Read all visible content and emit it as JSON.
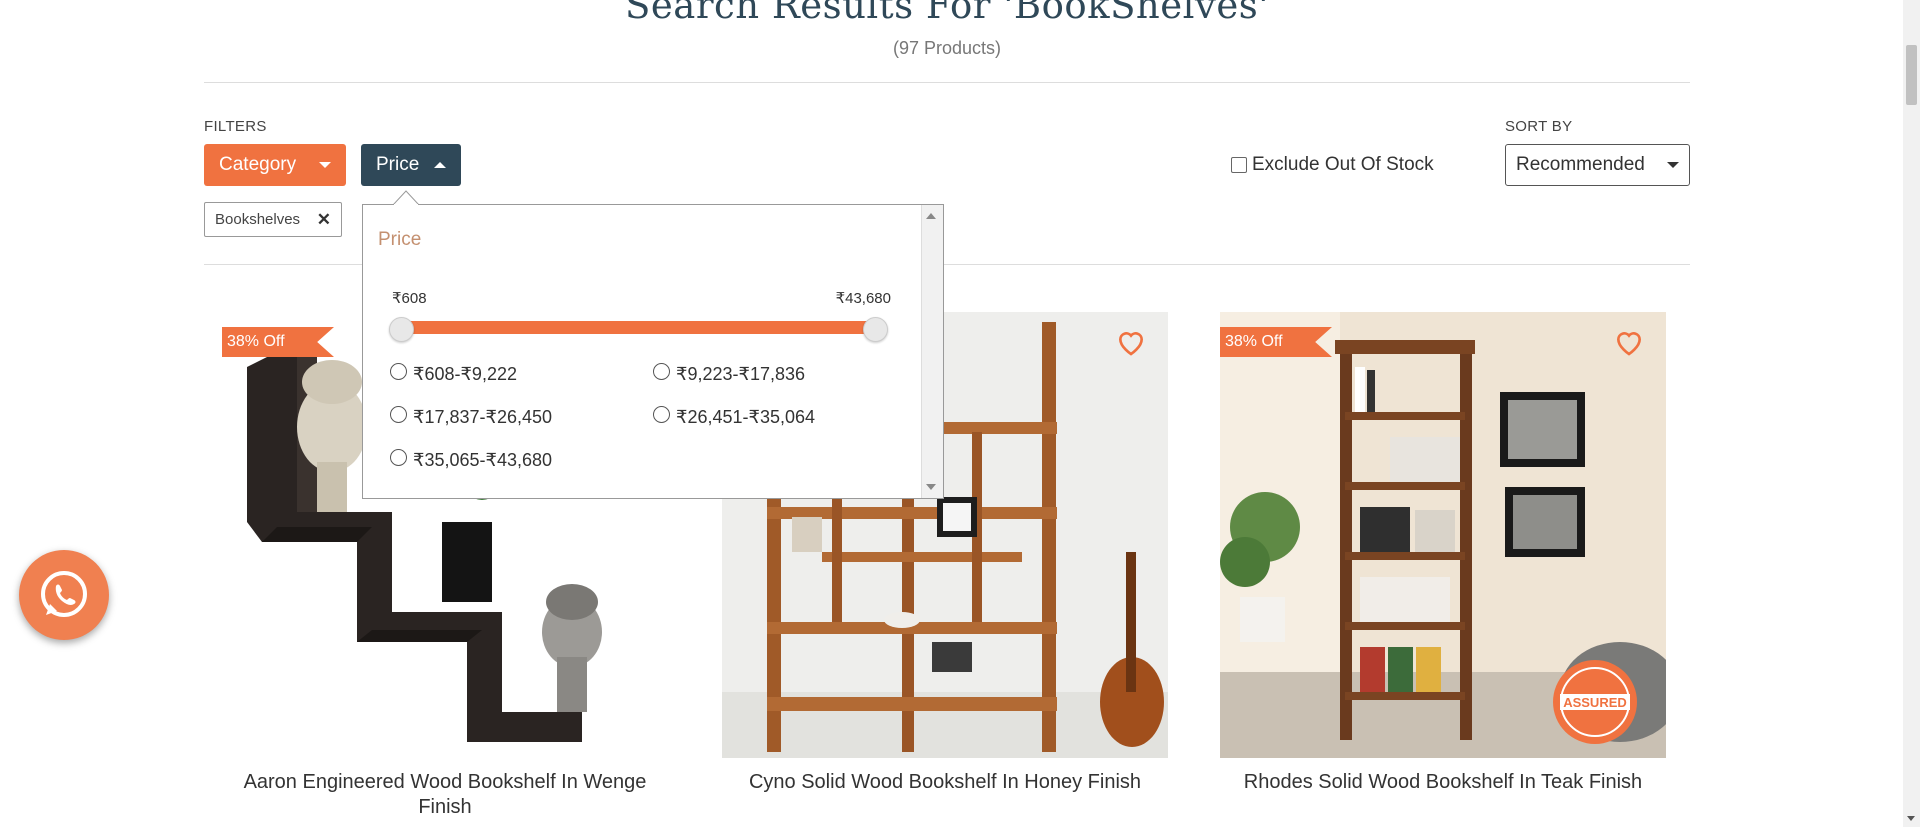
{
  "header": {
    "title": "Search Results For 'BookShelves'",
    "count": "(97 Products)"
  },
  "filters": {
    "label": "FILTERS",
    "category_label": "Category",
    "price_label": "Price",
    "exclude_label": "Exclude Out Of Stock",
    "active_chip": "Bookshelves"
  },
  "sort": {
    "label": "SORT BY",
    "selected": "Recommended"
  },
  "price_panel": {
    "title": "Price",
    "min": "₹608",
    "max": "₹43,680",
    "options": [
      "₹608-₹9,222",
      "₹9,223-₹17,836",
      "₹17,837-₹26,450",
      "₹26,451-₹35,064",
      "₹35,065-₹43,680"
    ]
  },
  "products": [
    {
      "name": "Aaron Engineered Wood Bookshelf In Wenge Finish",
      "badge": "38% Off"
    },
    {
      "name": "Cyno Solid Wood Bookshelf In Honey Finish",
      "badge": ""
    },
    {
      "name": "Rhodes Solid Wood Bookshelf In Teak Finish",
      "badge": "38% Off"
    }
  ],
  "icons": {
    "whatsapp": "whatsapp-icon",
    "wishlist": "heart-icon",
    "remove": "close-icon"
  },
  "colors": {
    "accent": "#f07240",
    "dark": "#2f4858"
  }
}
